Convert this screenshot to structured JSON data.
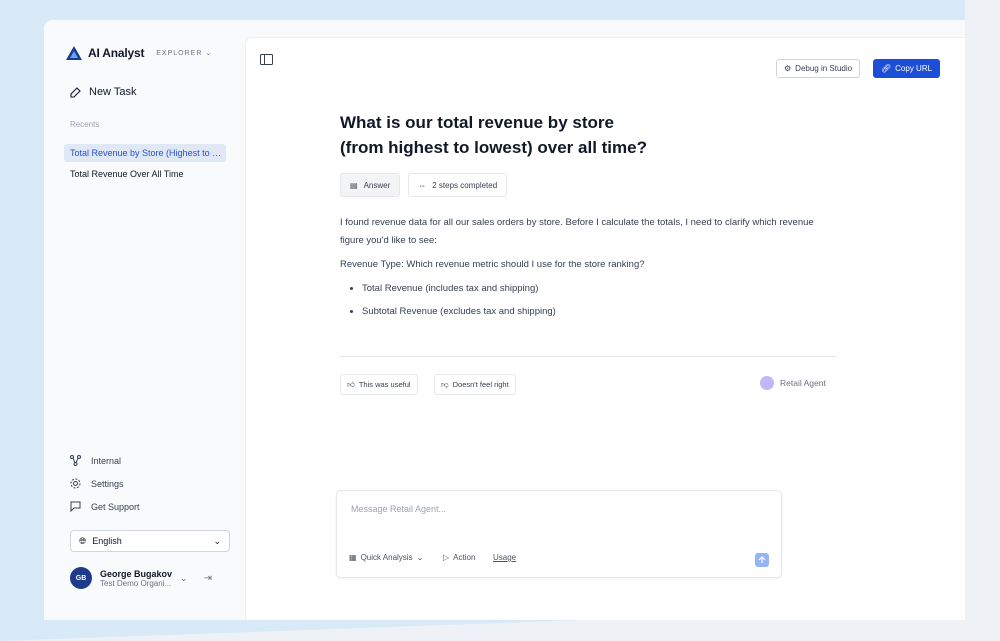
{
  "colors": {
    "accent": "#1d4ed8",
    "active_item_bg": "#e0e7f5",
    "background_blob": "#d8e9f8"
  },
  "brand": {
    "name": "AI Analyst",
    "mode": "EXPLORER"
  },
  "sidebar": {
    "new_task": "New Task",
    "recents_label": "Recents",
    "recents": [
      {
        "label": "Total Revenue by Store (Highest to Lowest)",
        "active": true
      },
      {
        "label": "Total Revenue Over All Time",
        "active": false
      }
    ],
    "bottom_items": [
      {
        "label": "Internal",
        "icon": "graph-icon"
      },
      {
        "label": "Settings",
        "icon": "gear-icon"
      },
      {
        "label": "Get Support",
        "icon": "chat-icon"
      }
    ],
    "language": "English",
    "user": {
      "initials": "GB",
      "name": "George Bugakov",
      "org": "Test Demo Organi..."
    }
  },
  "toolbar": {
    "debug_label": "Debug in Studio",
    "copy_label": "Copy URL"
  },
  "conversation": {
    "title_line1": "What is our total revenue by store",
    "title_line2": "(from highest to lowest) over all time?",
    "chips": {
      "answer": "Answer",
      "steps": "2 steps completed"
    },
    "paragraph1": "I found revenue data for all our sales orders by store. Before I calculate the totals, I need to clarify which revenue figure you'd like to see:",
    "paragraph2": "Revenue Type: Which revenue metric should I use for the store ranking?",
    "options": [
      "Total Revenue (includes tax and shipping)",
      "Subtotal Revenue (excludes tax and shipping)"
    ],
    "feedback": {
      "useful": "This was useful",
      "not_right": "Doesn't feel right"
    },
    "agent_name": "Retail Agent"
  },
  "composer": {
    "placeholder": "Message Retail Agent...",
    "quick_analysis": "Quick Analysis",
    "action": "Action",
    "usage": "Usage"
  }
}
